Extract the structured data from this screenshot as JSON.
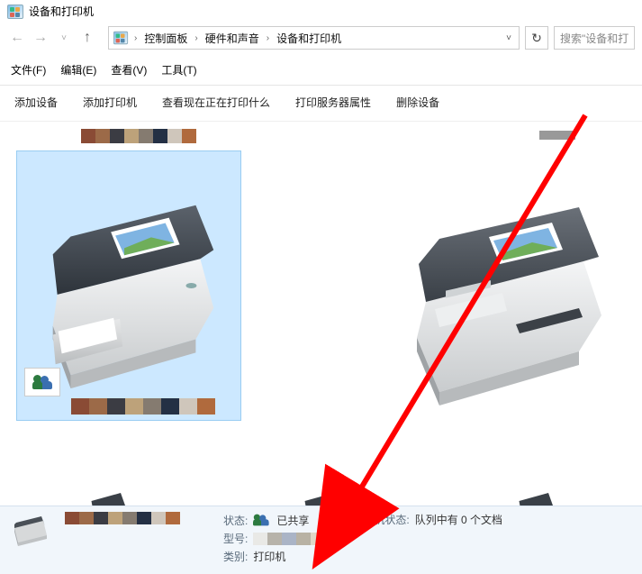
{
  "window": {
    "title": "设备和打印机"
  },
  "addressbar": {
    "breadcrumbs": [
      "控制面板",
      "硬件和声音",
      "设备和打印机"
    ],
    "search_placeholder": "搜索\"设备和打"
  },
  "menubar": {
    "file": "文件(F)",
    "edit": "编辑(E)",
    "view": "查看(V)",
    "tools": "工具(T)"
  },
  "toolbar": {
    "add_device": "添加设备",
    "add_printer": "添加打印机",
    "see_whats_printing": "查看现在正在打印什么",
    "print_server_properties": "打印服务器属性",
    "remove_device": "删除设备"
  },
  "swatches_top": [
    "#8a4b35",
    "#9c6a48",
    "#3b3c43",
    "#bda27a",
    "#857b70",
    "#243044",
    "#cfc6bb",
    "#b06a3d"
  ],
  "swatches_thumb": [
    "#8a4b35",
    "#9c6a48",
    "#3b3c43",
    "#bda27a",
    "#857b70",
    "#243044",
    "#cfc6bb",
    "#b06a3d"
  ],
  "status": {
    "state_label": "状态:",
    "state_value": "已共享",
    "model_label": "型号:",
    "category_label": "类别:",
    "category_value": "打印机",
    "printer_state_label": "打印机状态:",
    "printer_state_value": "队列中有 0 个文档",
    "model_swatches": [
      "#e9e9e6",
      "#b7b3aa",
      "#aab4c6",
      "#b8b2a4",
      "#dfd7c7"
    ]
  }
}
